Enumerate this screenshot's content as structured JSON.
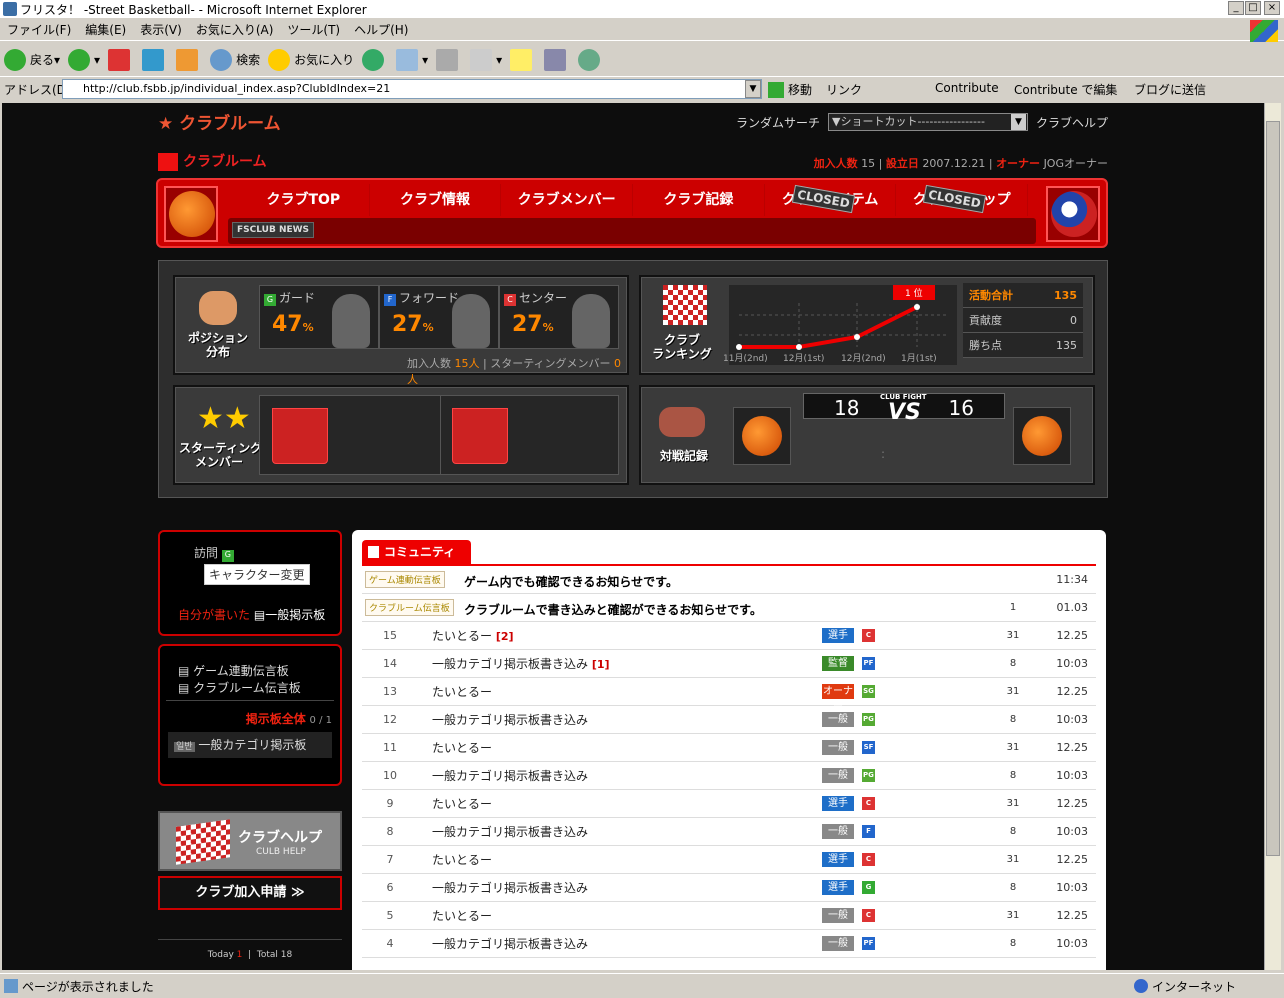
{
  "window": {
    "title": "フリスタ！ -Street Basketball- - Microsoft Internet Explorer",
    "min": "_",
    "max": "□",
    "close": "×"
  },
  "menu": [
    "ファイル(F)",
    "編集(E)",
    "表示(V)",
    "お気に入り(A)",
    "ツール(T)",
    "ヘルプ(H)"
  ],
  "toolbar": {
    "back": "戻る",
    "search": "検索",
    "favorites": "お気に入り"
  },
  "address": {
    "label": "アドレス(D)",
    "url": "http://club.fsbb.jp/individual_index.asp?ClubIdIndex=21",
    "go": "移動",
    "links": "リンク",
    "contribute": "Contribute",
    "contribute_edit": "Contribute で編集",
    "blog": "ブログに送信"
  },
  "status": {
    "text": "ページが表示されました",
    "zone": "インターネット"
  },
  "site": {
    "logo": "★ クラブルーム",
    "random": "ランダムサーチ",
    "shortcut": "▼ショートカット-----------------",
    "help": "クラブヘルプ"
  },
  "club": {
    "title": "クラブルーム",
    "members_label": "加入人数",
    "members": "15",
    "founded_label": "設立日",
    "founded": "2007.12.21",
    "owner_label": "オーナー",
    "owner": "JOGオーナー"
  },
  "nav": {
    "items": [
      "クラブTOP",
      "クラブ情報",
      "クラブメンバー",
      "クラブ記録",
      "クラブアイテム",
      "クラブショップ"
    ],
    "closed": "CLOSED",
    "news": "FSCLUB NEWS"
  },
  "position": {
    "label": "ポジション\n分布",
    "guard": "ガード",
    "forward": "フォワード",
    "center": "センター",
    "guard_pct": "47",
    "forward_pct": "27",
    "center_pct": "27",
    "pct": "%",
    "members_label": "加入人数",
    "members": "15人",
    "starting_label": "スターティングメンバー",
    "starting": "0人",
    "g": "G",
    "f": "F",
    "c": "C"
  },
  "ranking": {
    "label": "クラブ\nランキング",
    "badge": "1 位",
    "x": [
      "11月(2nd)",
      "12月(1st)",
      "12月(2nd)",
      "1月(1st)"
    ],
    "activity_label": "活動合計",
    "activity": "135",
    "contrib_label": "貢献度",
    "contrib": "0",
    "wins_label": "勝ち点",
    "wins": "135"
  },
  "starting": {
    "label": "スターティング\nメンバー"
  },
  "match": {
    "label": "対戦記録",
    "score_a": "18",
    "score_b": "16",
    "vs": "VS",
    "club_fight": "CLUB FIGHT",
    "colon": ":"
  },
  "left": {
    "visit": "訪問",
    "char_change": "キャラクター変更",
    "mine": "自分が書いた",
    "general": "一般掲示板",
    "game_board": "ゲーム連動伝言板",
    "club_board": "クラブルーム伝言板",
    "all": "掲示板全体",
    "all_count": "0 / 1",
    "cat_tag": "일반",
    "cat": "一般カテゴリ掲示板",
    "help": "クラブヘルプ",
    "help_en": "CULB HELP",
    "join": "クラブ加入申請 ≫",
    "today_label": "Today",
    "today": "1",
    "total_label": "Total",
    "total": "18"
  },
  "community": {
    "tab": "コミュニティ",
    "notices": [
      {
        "tag": "ゲーム連動伝言板",
        "title": "ゲーム内でも確認できるお知らせです。",
        "count": "",
        "time": "11:34"
      },
      {
        "tag": "クラブルーム伝言板",
        "title": "クラブルームで書き込みと確認ができるお知らせです。",
        "count": "1",
        "time": "01.03"
      }
    ],
    "rows": [
      {
        "no": "15",
        "title": "たいとるー",
        "comment": "[2]",
        "rank": "選手",
        "pos": "C",
        "count": "31",
        "time": "12.25"
      },
      {
        "no": "14",
        "title": "一般カテゴリ掲示板書き込み",
        "comment": "[1]",
        "rank": "監督",
        "pos": "PF",
        "count": "8",
        "time": "10:03"
      },
      {
        "no": "13",
        "title": "たいとるー",
        "comment": "",
        "rank": "オーナー",
        "pos": "SG",
        "count": "31",
        "time": "12.25"
      },
      {
        "no": "12",
        "title": "一般カテゴリ掲示板書き込み",
        "comment": "",
        "rank": "一般",
        "pos": "PG",
        "count": "8",
        "time": "10:03"
      },
      {
        "no": "11",
        "title": "たいとるー",
        "comment": "",
        "rank": "一般",
        "pos": "SF",
        "count": "31",
        "time": "12.25"
      },
      {
        "no": "10",
        "title": "一般カテゴリ掲示板書き込み",
        "comment": "",
        "rank": "一般",
        "pos": "PG",
        "count": "8",
        "time": "10:03"
      },
      {
        "no": "9",
        "title": "たいとるー",
        "comment": "",
        "rank": "選手",
        "pos": "C",
        "count": "31",
        "time": "12.25"
      },
      {
        "no": "8",
        "title": "一般カテゴリ掲示板書き込み",
        "comment": "",
        "rank": "一般",
        "pos": "F",
        "count": "8",
        "time": "10:03"
      },
      {
        "no": "7",
        "title": "たいとるー",
        "comment": "",
        "rank": "選手",
        "pos": "C",
        "count": "31",
        "time": "12.25"
      },
      {
        "no": "6",
        "title": "一般カテゴリ掲示板書き込み",
        "comment": "",
        "rank": "選手",
        "pos": "G",
        "count": "8",
        "time": "10:03"
      },
      {
        "no": "5",
        "title": "たいとるー",
        "comment": "",
        "rank": "一般",
        "pos": "C",
        "count": "31",
        "time": "12.25"
      },
      {
        "no": "4",
        "title": "一般カテゴリ掲示板書き込み",
        "comment": "",
        "rank": "一般",
        "pos": "PF",
        "count": "8",
        "time": "10:03"
      }
    ]
  },
  "colors": {
    "accent": "#e00000",
    "orange": "#ff8800",
    "rank_player": "#1e6ec8",
    "rank_coach": "#3a8a2a",
    "rank_owner": "#e03a10",
    "rank_general": "#888888"
  }
}
